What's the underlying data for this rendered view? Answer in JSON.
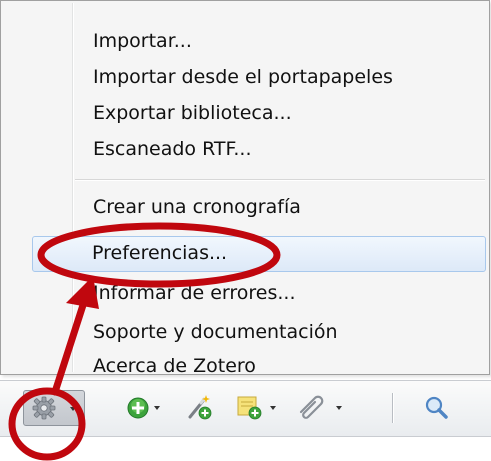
{
  "menu": {
    "items": [
      {
        "label": "Importar..."
      },
      {
        "label": "Importar desde el portapapeles"
      },
      {
        "label": "Exportar biblioteca..."
      },
      {
        "label": "Escaneado RTF..."
      },
      {
        "label": "Crear una cronografía"
      },
      {
        "label": "Preferencias..."
      },
      {
        "label": "Informar de errores..."
      },
      {
        "label": "Soporte y documentación"
      },
      {
        "label": "Acerca de Zotero"
      }
    ],
    "highlighted_index": 5
  },
  "toolbar": {
    "buttons": [
      {
        "icon": "gear-icon",
        "has_dropdown": true,
        "pressed": true
      },
      {
        "icon": "add-green-icon",
        "has_dropdown": true
      },
      {
        "icon": "magic-wand-icon",
        "has_dropdown": false
      },
      {
        "icon": "new-note-icon",
        "has_dropdown": true
      },
      {
        "icon": "paperclip-icon",
        "has_dropdown": true
      },
      {
        "icon": "search-icon",
        "has_dropdown": false
      }
    ]
  },
  "annotation": {
    "color": "#c0070e"
  }
}
